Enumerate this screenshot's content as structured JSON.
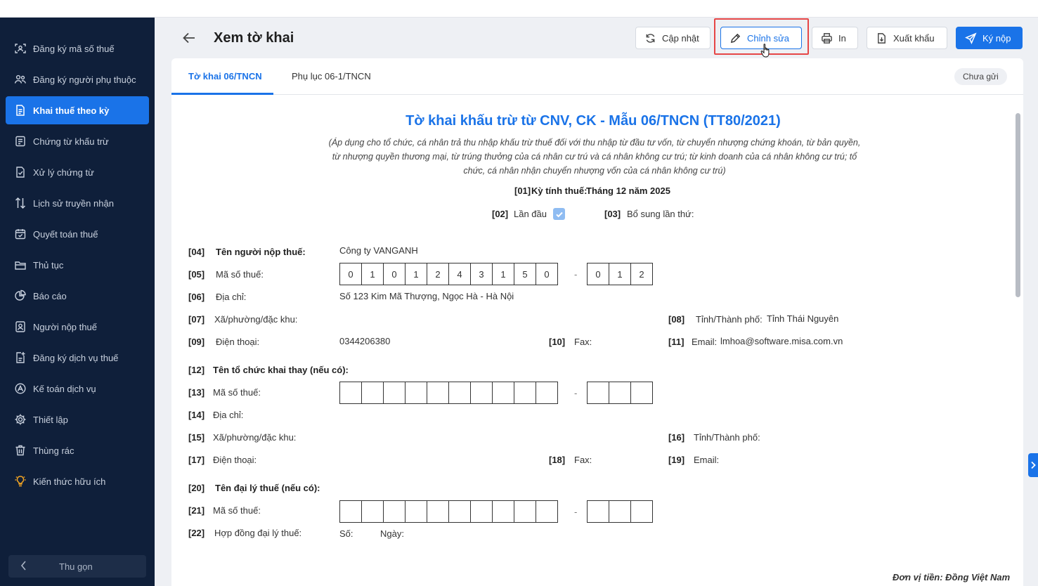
{
  "sidebar": {
    "items": [
      {
        "label": "Đăng ký mã số thuế",
        "icon": "scan-user-icon"
      },
      {
        "label": "Đăng ký người phụ thuộc",
        "icon": "users-icon"
      },
      {
        "label": "Khai thuế theo kỳ",
        "icon": "document-icon"
      },
      {
        "label": "Chứng từ khấu trừ",
        "icon": "receipt-icon"
      },
      {
        "label": "Xử lý chứng từ",
        "icon": "file-check-icon"
      },
      {
        "label": "Lịch sử truyền nhận",
        "icon": "transfer-arrows-icon"
      },
      {
        "label": "Quyết toán thuế",
        "icon": "calendar-check-icon"
      },
      {
        "label": "Thủ tục",
        "icon": "folder-icon"
      },
      {
        "label": "Báo cáo",
        "icon": "pie-chart-icon"
      },
      {
        "label": "Người nộp thuế",
        "icon": "user-card-icon"
      },
      {
        "label": "Đăng ký dịch vụ thuế",
        "icon": "file-plus-icon"
      },
      {
        "label": "Kế toán dịch vụ",
        "icon": "circle-chart-icon"
      },
      {
        "label": "Thiết lập",
        "icon": "gear-icon"
      },
      {
        "label": "Thùng rác",
        "icon": "trash-icon"
      },
      {
        "label": "Kiến thức hữu ích",
        "icon": "lightbulb-icon"
      }
    ],
    "collapse_label": "Thu gọn"
  },
  "header": {
    "title": "Xem tờ khai",
    "buttons": {
      "update": "Cập nhật",
      "edit": "Chỉnh sửa",
      "print": "In",
      "export": "Xuất khẩu",
      "sign": "Ký nộp"
    }
  },
  "tabs": {
    "main": "Tờ khai 06/TNCN",
    "appendix": "Phụ lục 06-1/TNCN",
    "status": "Chưa gửi"
  },
  "form": {
    "title": "Tờ khai khấu trừ từ CNV, CK - Mẫu 06/TNCN (TT80/2021)",
    "subtitle_lines": [
      "(Áp dụng cho tổ chức, cá nhân trả thu nhập khấu trừ thuế đối với thu nhập từ đầu tư vốn, từ chuyển nhượng chứng khoán, từ bản quyền,",
      "từ nhượng quyền thương mại, từ trúng thưởng của cá nhân cư trú và cá nhân không cư trú; từ kinh doanh của cá nhân không cư trú; tổ",
      "chức, cá nhân nhận chuyển nhượng vốn của cá nhân không cư trú)"
    ],
    "period_code": "[01]",
    "period_label": "Kỳ tính thuế:",
    "period_value": "Tháng 12 năm 2025",
    "first_code": "[02]",
    "first_label": "Lần đầu",
    "first_checked": true,
    "supplement_code": "[03]",
    "supplement_label": "Bổ sung lần thứ:",
    "f04_code": "[04]",
    "f04_label": "Tên người nộp thuế:",
    "f04_value": "Công ty VANGANH",
    "f05_code": "[05]",
    "f05_label": "Mã số thuế:",
    "tax_id_main": [
      "0",
      "1",
      "0",
      "1",
      "2",
      "4",
      "3",
      "1",
      "5",
      "0"
    ],
    "tax_id_branch": [
      "0",
      "1",
      "2"
    ],
    "separator": "-",
    "f06_code": "[06]",
    "f06_label": "Địa chỉ:",
    "f06_value": "Số 123 Kim Mã Thượng, Ngọc Hà - Hà Nội",
    "f07_code": "[07]",
    "f07_label": "Xã/phường/đặc khu:",
    "f08_code": "[08]",
    "f08_label": "Tỉnh/Thành phố:",
    "f08_value": "Tỉnh Thái Nguyên",
    "f09_code": "[09]",
    "f09_label": "Điện thoại:",
    "f09_value": "0344206380",
    "f10_code": "[10]",
    "f10_label": "Fax:",
    "f11_code": "[11]",
    "f11_label": "Email:",
    "f11_value": "lmhoa@software.misa.com.vn",
    "f12_code": "[12]",
    "f12_label": "Tên tổ chức khai thay (nếu có):",
    "f13_code": "[13]",
    "f13_label": "Mã số thuế:",
    "f14_code": "[14]",
    "f14_label": "Địa chỉ:",
    "f15_code": "[15]",
    "f15_label": "Xã/phường/đặc khu:",
    "f16_code": "[16]",
    "f16_label": "Tỉnh/Thành phố:",
    "f17_code": "[17]",
    "f17_label": "Điện thoại:",
    "f18_code": "[18]",
    "f18_label": "Fax:",
    "f19_code": "[19]",
    "f19_label": "Email:",
    "f20_code": "[20]",
    "f20_label": "Tên đại lý thuế (nếu có):",
    "f21_code": "[21]",
    "f21_label": "Mã số thuế:",
    "f22_code": "[22]",
    "f22_label": "Hợp đồng đại lý thuế:",
    "f22_no_label": "Số:",
    "f22_date_label": "Ngày:",
    "currency_note": "Đơn vị tiền: Đồng Việt Nam"
  },
  "colors": {
    "sidebar_bg": "#0f1f3a",
    "accent": "#1a73e8",
    "highlight": "#e64646"
  }
}
